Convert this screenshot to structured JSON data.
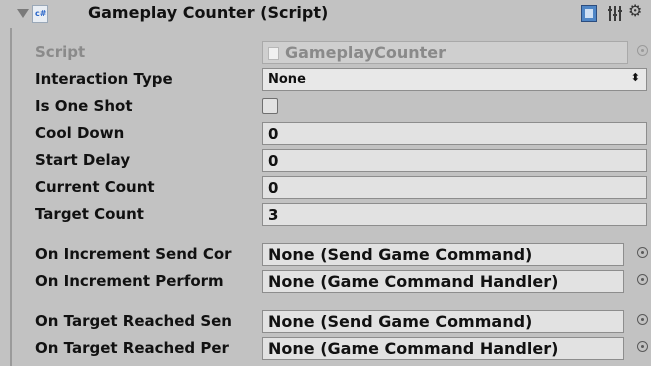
{
  "component": {
    "title": "Gameplay Counter (Script)"
  },
  "fields": {
    "script": {
      "label": "Script",
      "value": "GameplayCounter"
    },
    "interaction_type": {
      "label": "Interaction Type",
      "value": "None"
    },
    "is_one_shot": {
      "label": "Is One Shot",
      "checked": false
    },
    "cool_down": {
      "label": "Cool Down",
      "value": "0"
    },
    "start_delay": {
      "label": "Start Delay",
      "value": "0"
    },
    "current_count": {
      "label": "Current Count",
      "value": "0"
    },
    "target_count": {
      "label": "Target Count",
      "value": "3"
    }
  },
  "events": [
    {
      "label": "On Increment Send Cor",
      "value": "None (Send Game Command)"
    },
    {
      "label": "On Increment Perform",
      "value": "None (Game Command Handler)"
    },
    {
      "label": "On Target Reached Sen",
      "value": "None (Send Game Command)"
    },
    {
      "label": "On Target Reached Per",
      "value": "None (Game Command Handler)"
    }
  ],
  "icons": {
    "fold": "foldout-triangle-icon",
    "script": "csharp-script-icon",
    "help": "help-book-icon",
    "layout": "presets-icon",
    "settings": "gear-icon",
    "object_picker": "object-picker-icon"
  }
}
